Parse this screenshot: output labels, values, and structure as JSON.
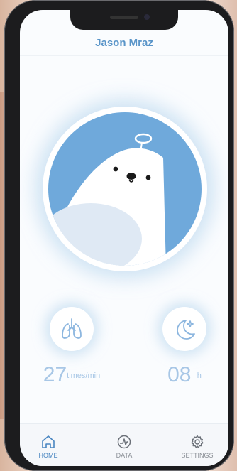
{
  "header": {
    "title": "Jason Mraz"
  },
  "avatar": {
    "icon": "bear-with-halo-icon"
  },
  "metrics": {
    "breathing": {
      "icon": "lungs-icon",
      "value": "27",
      "unit": "times/min"
    },
    "sleep": {
      "icon": "moon-icon",
      "value": "08",
      "unit": "h"
    }
  },
  "tabbar": {
    "home": {
      "label": "HOME",
      "icon": "home-icon",
      "active": true
    },
    "data": {
      "label": "DATA",
      "icon": "pulse-chart-icon"
    },
    "settings": {
      "label": "SETTINGS",
      "icon": "gear-icon"
    }
  },
  "colors": {
    "accent": "#5a95c9",
    "light_accent": "#a8c7e6",
    "avatar_bg": "#6fa9db"
  }
}
